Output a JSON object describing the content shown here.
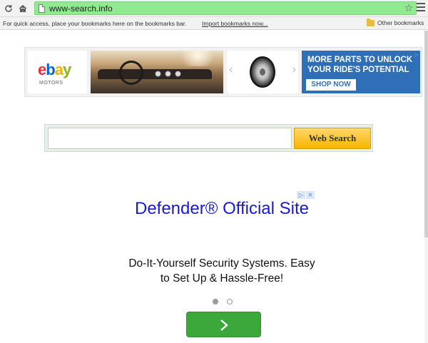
{
  "browser": {
    "url": "www-search.info",
    "bookmarks_hint": "For quick access, place your bookmarks here on the bookmarks bar.",
    "import_link": "Import bookmarks now...",
    "other_bookmarks": "Other bookmarks",
    "icons": [
      "reload-icon",
      "home-icon",
      "page-icon",
      "star-icon",
      "menu-icon",
      "folder-icon"
    ]
  },
  "banner_ad": {
    "brand_sub": "MOTORS",
    "promo_text": "MORE PARTS TO UNLOCK YOUR RIDE'S POTENTIAL",
    "cta": "SHOP NOW",
    "brand_colors": [
      "#e53238",
      "#0064d2",
      "#f5af02",
      "#86b817"
    ],
    "accent": "#2f6fb7"
  },
  "search": {
    "value": "",
    "button_label": "Web Search"
  },
  "native_ad": {
    "title": "Defender® Official Site",
    "description": "Do-It-Yourself Security Systems. Easy to Set Up & Hassle-Free!",
    "slide_count": 2,
    "active_slide": 1,
    "cta_icon": "chevron-right-icon",
    "cta_color": "#3ca83c"
  }
}
